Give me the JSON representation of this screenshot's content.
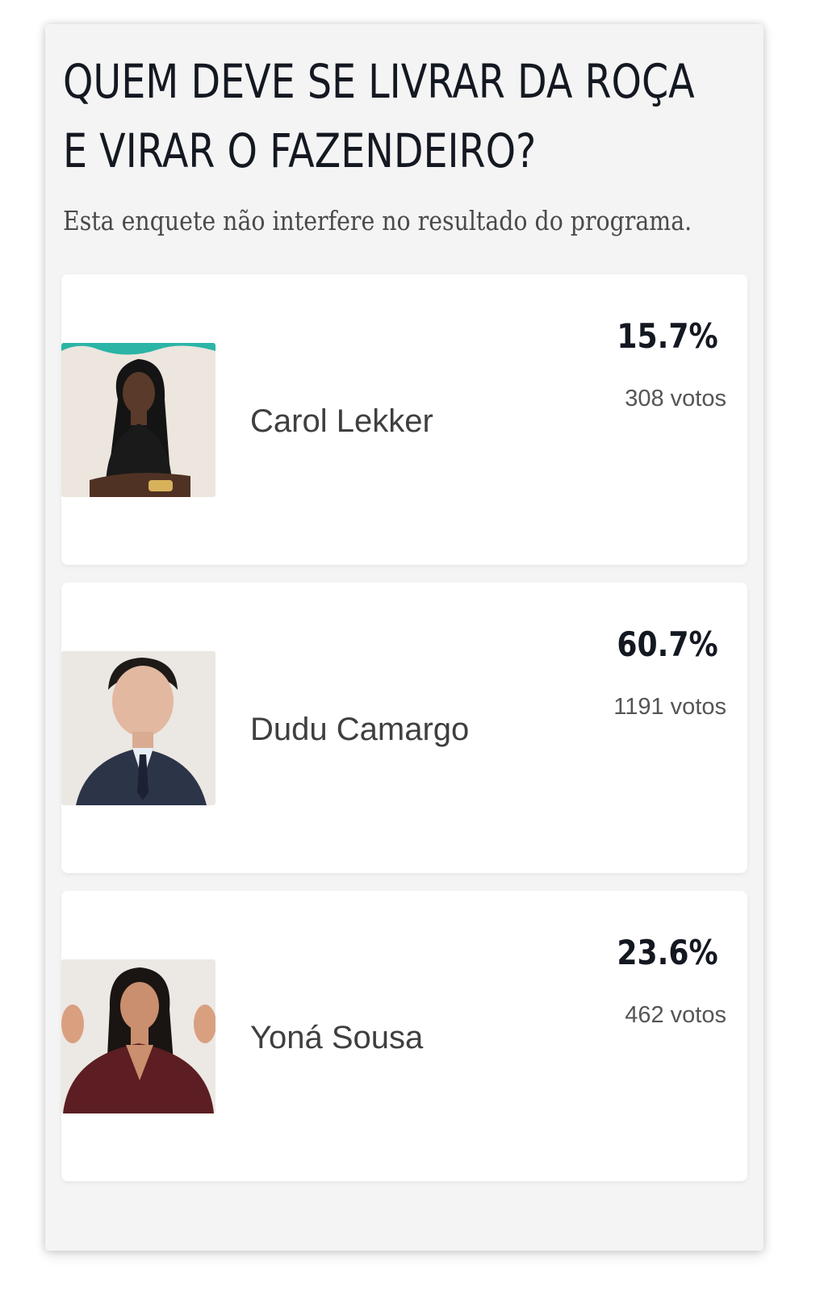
{
  "poll": {
    "title_line1": "QUEM DEVE SE LIVRAR DA ROÇA",
    "title_line2": "E VIRAR O FAZENDEIRO?",
    "subtitle": "Esta enquete não interfere no resultado do programa.",
    "options": [
      {
        "name": "Carol Lekker",
        "percent": "15.7%",
        "votes": "308 votos",
        "photo_icon": "person-photo-woman-black-dress"
      },
      {
        "name": "Dudu Camargo",
        "percent": "60.7%",
        "votes": "1191 votos",
        "photo_icon": "person-photo-man-suit"
      },
      {
        "name": "Yoná Sousa",
        "percent": "23.6%",
        "votes": "462 votos",
        "photo_icon": "person-photo-woman-leather-jacket"
      }
    ]
  },
  "colors": {
    "panel_background": "#f4f4f5",
    "card_background": "#ffffff",
    "title_text": "#141821",
    "name_text": "#3f3f3f",
    "votes_text": "#555555"
  }
}
